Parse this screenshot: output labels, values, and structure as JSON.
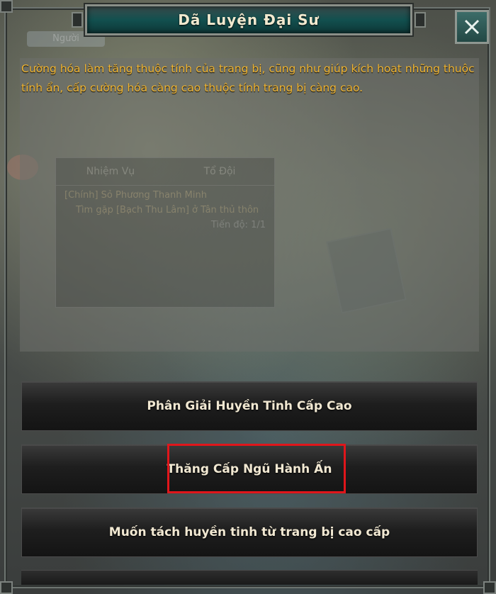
{
  "dialog": {
    "title": "Dã Luyện Đại Sư",
    "close_icon": "close-icon",
    "description": "Cường hóa làm tăng thuộc tính của trang bị, cũng như giúp kích hoạt những thuộc tính ẩn, cấp cường hóa càng cao thuộc tính trang bị càng cao.",
    "buttons": [
      {
        "label": "Phân Giải Huyền Tinh Cấp Cao"
      },
      {
        "label": "Thăng Cấp Ngũ Hành Ấn"
      },
      {
        "label": "Muốn tách huyền tinh từ trang bị cao cấp"
      }
    ]
  },
  "background": {
    "ghost_tab": "Người",
    "quest_tabs": [
      "Nhiệm Vụ",
      "Tổ Đội"
    ],
    "quest_title": "[Chính] Sỏ Phương Thanh Minh",
    "quest_desc": "Tìm gặp [Bạch Thu Lâm] ở Tân thủ thôn",
    "quest_progress": "Tiến độ: 1/1"
  },
  "colors": {
    "description_text": "#f2b632",
    "highlight_border": "#e0161b",
    "title_banner": "#12504f"
  }
}
